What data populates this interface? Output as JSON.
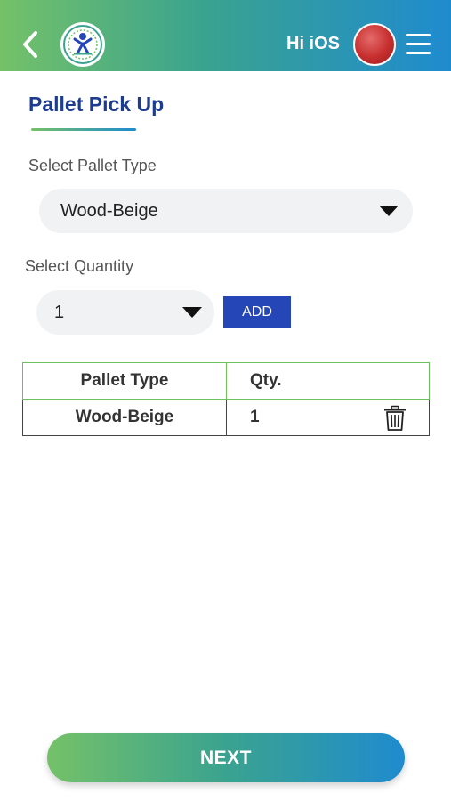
{
  "header": {
    "greeting": "Hi iOS",
    "icons": {
      "back": "chevron-left-icon",
      "logo": "logo-icon",
      "avatar": "avatar",
      "menu": "hamburger-menu-icon"
    },
    "colors": {
      "gradient_start": "#74c168",
      "gradient_end": "#1f8bcf"
    }
  },
  "page": {
    "title": "Pallet Pick Up",
    "title_color": "#1e3c8f"
  },
  "form": {
    "pallet_type": {
      "label": "Select Pallet Type",
      "value": "Wood-Beige"
    },
    "quantity": {
      "label": "Select Quantity",
      "value": "1"
    },
    "add_label": "ADD",
    "add_color": "#2546b7"
  },
  "table": {
    "headers": {
      "type": "Pallet Type",
      "qty": "Qty."
    },
    "rows": [
      {
        "type": "Wood-Beige",
        "qty": "1",
        "action_icon": "trash-icon"
      }
    ]
  },
  "footer": {
    "next_label": "NEXT"
  }
}
